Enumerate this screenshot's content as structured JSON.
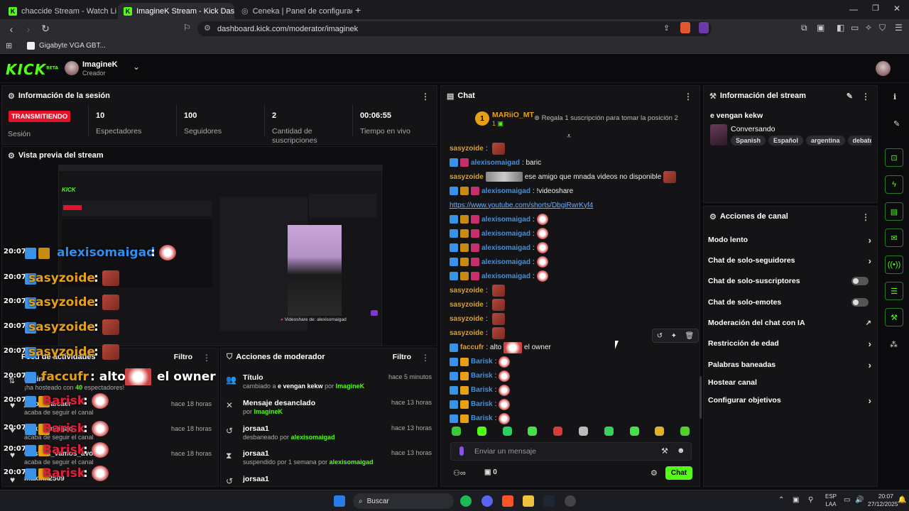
{
  "browser": {
    "tabs": [
      {
        "label": "chaccide Stream - Watch Live on",
        "active": false
      },
      {
        "label": "ImagineK Stream - Kick Dashb",
        "active": true
      },
      {
        "label": "Ceneka | Panel de configuración",
        "active": false
      }
    ],
    "url": "dashboard.kick.com/moderator/imaginek",
    "bookmark": "Gigabyte VGA GBT..."
  },
  "header": {
    "logo": "KICK",
    "logo_badge": "BETA",
    "user_name": "ImagineK",
    "user_role": "Creador"
  },
  "session": {
    "title": "Información de la sesión",
    "live_badge": "TRANSMITIENDO",
    "live_label": "Sesión",
    "stats": [
      {
        "value": "10",
        "label": "Espectadores"
      },
      {
        "value": "100",
        "label": "Seguidores"
      },
      {
        "value": "2",
        "label": "Cantidad de suscripciones"
      },
      {
        "value": "00:06:55",
        "label": "Tiempo en vivo"
      }
    ]
  },
  "preview": {
    "title": "Vista previa del stream",
    "videoshare": "Videoshare de: alexisomaigad"
  },
  "overlay": [
    {
      "time": "20:07",
      "user": "alexisomaigad",
      "color": "#2f8ff0"
    },
    {
      "time": "20:07",
      "user": "sasyzoide",
      "color": "#e4a019"
    },
    {
      "time": "20:07",
      "user": "sasyzoide",
      "color": "#e4a019"
    },
    {
      "time": "20:07",
      "user": "sasyzoide",
      "color": "#e4a019"
    },
    {
      "time": "20:07",
      "user": "sasyzoide",
      "color": "#e4a019"
    },
    {
      "time": "20:07",
      "user": "faccufr",
      "color": "#e4a019",
      "text": ": alto",
      "text2": "el owner"
    },
    {
      "time": "20:07",
      "user": "Barisk",
      "color": "#e0203a"
    },
    {
      "time": "20:07",
      "user": "Barisk",
      "color": "#e0203a"
    },
    {
      "time": "20:07",
      "user": "Barisk",
      "color": "#e0203a"
    },
    {
      "time": "20:07",
      "user": "Barisk",
      "color": "#e0203a"
    }
  ],
  "activity": {
    "title": "Feed de actividades",
    "filter": "Filtro",
    "items": [
      {
        "name": "bocin",
        "desc": "¡ha hosteado con ",
        "count": "40",
        "desc2": " espectadores!",
        "time": ""
      },
      {
        "name": "jullos_vaicaer",
        "desc": "acaba de seguir el canal",
        "time": "hace 18 horas"
      },
      {
        "name": "alexisomaigad",
        "desc": "acaba de seguir el canal",
        "time": "hace 18 horas"
      },
      {
        "name": "Cristina_vamos_avolve",
        "desc": "acaba de seguir el canal",
        "time": "hace 18 horas"
      },
      {
        "name": "maxink2509",
        "desc": "",
        "time": ""
      }
    ]
  },
  "modactions": {
    "title": "Acciones de moderador",
    "filter": "Filtro",
    "items": [
      {
        "title": "Título",
        "pre": "cambiado a ",
        "bold": "e vengan kekw",
        "mid": " por ",
        "by": "ImagineK",
        "time": "hace 5 minutos",
        "icon": "👥"
      },
      {
        "title": "Mensaje desanclado",
        "pre": "por ",
        "bold": "",
        "mid": "",
        "by": "ImagineK",
        "time": "hace 13 horas",
        "icon": "✕"
      },
      {
        "title": "jorsaa1",
        "pre": "desbaneado por ",
        "bold": "",
        "mid": "",
        "by": "alexisomaigad",
        "time": "hace 13 horas",
        "icon": "↺"
      },
      {
        "title": "jorsaa1",
        "pre": "suspendido por 1 semana por ",
        "bold": "",
        "mid": "",
        "by": "alexisomaigad",
        "time": "hace 13 horas",
        "icon": "⧗"
      },
      {
        "title": "jorsaa1",
        "pre": "",
        "bold": "",
        "mid": "",
        "by": "",
        "time": "",
        "icon": "↺"
      }
    ]
  },
  "chat": {
    "title": "Chat",
    "top_user": "MARiiO_MT",
    "top_rank": "1",
    "top_count": "1",
    "gift_text": "Regala 1 suscripción para tomar la posición 2",
    "messages": [
      {
        "user": "sasyzoide",
        "color": "#e4a019",
        "badges": [],
        "text": ""
      },
      {
        "user": "alexisomaigad",
        "color": "#3a92e8",
        "badges": [
          "b1",
          "b3"
        ],
        "text": ": baric"
      },
      {
        "user": "sasyzoide",
        "color": "#e4a019",
        "badges": [],
        "text": "ese amigo que mnada videos no disponible"
      },
      {
        "user": "alexisomaigad",
        "color": "#3a92e8",
        "badges": [
          "b1",
          "b2",
          "b3"
        ],
        "text": ": !videoshare"
      },
      {
        "user": "",
        "color": "#3a92e8",
        "badges": [],
        "text": "https://www.youtube.com/shorts/DbgiRwrKyf4",
        "link": true
      },
      {
        "user": "alexisomaigad",
        "color": "#3a92e8",
        "badges": [
          "b1",
          "b2",
          "b3"
        ],
        "text": ":"
      },
      {
        "user": "alexisomaigad",
        "color": "#3a92e8",
        "badges": [
          "b1",
          "b2",
          "b3"
        ],
        "text": ":"
      },
      {
        "user": "alexisomaigad",
        "color": "#3a92e8",
        "badges": [
          "b1",
          "b2",
          "b3"
        ],
        "text": ":"
      },
      {
        "user": "alexisomaigad",
        "color": "#3a92e8",
        "badges": [
          "b1",
          "b2",
          "b3"
        ],
        "text": ":"
      },
      {
        "user": "alexisomaigad",
        "color": "#3a92e8",
        "badges": [
          "b1",
          "b2",
          "b3"
        ],
        "text": ":"
      },
      {
        "user": "sasyzoide",
        "color": "#e4a019",
        "badges": [],
        "text": ""
      },
      {
        "user": "sasyzoide",
        "color": "#e4a019",
        "badges": [],
        "text": ""
      },
      {
        "user": "sasyzoide",
        "color": "#e4a019",
        "badges": [],
        "text": ""
      },
      {
        "user": "sasyzoide",
        "color": "#e4a019",
        "badges": [],
        "text": ""
      },
      {
        "user": "faccufr",
        "color": "#e4a019",
        "badges": [
          "b1"
        ],
        "text": ": alto",
        "text2": "el owner"
      },
      {
        "user": "Barisk",
        "color": "#3a92e8",
        "badges": [
          "b1",
          "b4"
        ],
        "text": ":"
      },
      {
        "user": "Barisk",
        "color": "#3a92e8",
        "badges": [
          "b1",
          "b4"
        ],
        "text": ":"
      },
      {
        "user": "Barisk",
        "color": "#3a92e8",
        "badges": [
          "b1",
          "b4"
        ],
        "text": ":"
      },
      {
        "user": "Barisk",
        "color": "#3a92e8",
        "badges": [
          "b1",
          "b4"
        ],
        "text": ":"
      },
      {
        "user": "Barisk",
        "color": "#3a92e8",
        "badges": [
          "b1",
          "b4"
        ],
        "text": ":"
      }
    ],
    "input_placeholder": "Enviar un mensaje",
    "viewer_count": "0",
    "send_label": "Chat"
  },
  "stream_info": {
    "title": "Información del stream",
    "stream_title": "e vengan kekw",
    "category": "Conversando",
    "tags": [
      "Spanish",
      "Español",
      "argentina",
      "debate"
    ]
  },
  "channel_actions": {
    "title": "Acciones de canal",
    "items": [
      {
        "label": "Modo lento",
        "control": "chevron"
      },
      {
        "label": "Chat de solo-seguidores",
        "control": "chevron"
      },
      {
        "label": "Chat de solo-suscriptores",
        "control": "toggle"
      },
      {
        "label": "Chat de solo-emotes",
        "control": "toggle"
      },
      {
        "label": "Moderación del chat con IA",
        "control": "external"
      },
      {
        "label": "Restricción de edad",
        "control": "chevron"
      },
      {
        "label": "Palabras baneadas",
        "control": "chevron"
      },
      {
        "label": "Hostear canal",
        "control": "none"
      },
      {
        "label": "Configurar objetivos",
        "control": "chevron"
      }
    ]
  },
  "taskbar": {
    "search": "Buscar",
    "lang": "ESP",
    "lang2": "LAA",
    "time": "20:07",
    "date": "27/12/2025"
  },
  "colors": {
    "kick_green": "#53fc18",
    "live_red": "#e5122b"
  }
}
